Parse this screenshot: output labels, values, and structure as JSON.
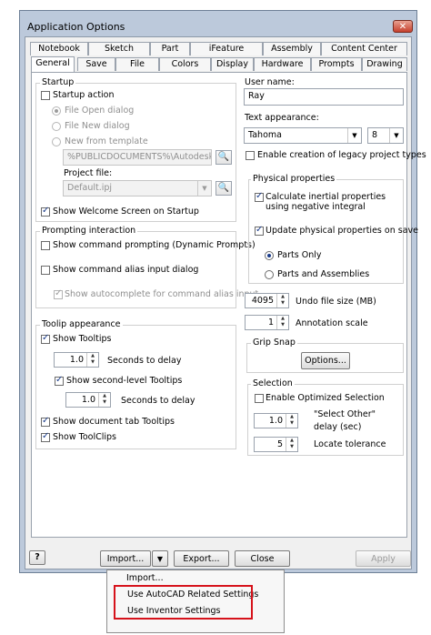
{
  "window": {
    "title": "Application Options",
    "close_glyph": "✕"
  },
  "tabs_row1": [
    "Notebook",
    "Sketch",
    "Part",
    "iFeature",
    "Assembly",
    "Content Center"
  ],
  "tabs_row2": [
    "General",
    "Save",
    "File",
    "Colors",
    "Display",
    "Hardware",
    "Prompts",
    "Drawing"
  ],
  "startup": {
    "group_label": "Startup",
    "startup_action": "Startup action",
    "file_open": "File Open dialog",
    "file_new": "File New dialog",
    "new_from_template": "New from template",
    "template_path": "%PUBLICDOCUMENTS%\\Autodesk\\Inv",
    "project_file_label": "Project file:",
    "project_file_value": "Default.ipj",
    "welcome_screen": "Show Welcome Screen on Startup"
  },
  "prompting": {
    "group_label": "Prompting interaction",
    "dynamic_prompts": "Show command prompting (Dynamic Prompts)",
    "alias_dialog": "Show command alias input dialog",
    "autocomplete": "Show autocomplete for command alias input"
  },
  "tooltip": {
    "group_label": "Toolip appearance",
    "show_tooltips": "Show Tooltips",
    "delay_value": "1.0",
    "delay_label": "Seconds to delay",
    "second_level": "Show second-level Tooltips",
    "delay2_value": "1.0",
    "delay2_label": "Seconds to delay",
    "doc_tab": "Show document tab Tooltips",
    "toolclips": "Show ToolClips"
  },
  "user": {
    "label": "User name:",
    "value": "Ray"
  },
  "text_appearance": {
    "label": "Text appearance:",
    "font": "Tahoma",
    "size": "8",
    "legacy": "Enable creation of legacy project types"
  },
  "physical": {
    "group_label": "Physical properties",
    "inertial": "Calculate inertial properties using negative integral",
    "update": "Update physical properties on save",
    "parts_only": "Parts Only",
    "parts_assemblies": "Parts and Assemblies"
  },
  "undo": {
    "value": "4095",
    "label": "Undo file size (MB)"
  },
  "annotation": {
    "value": "1",
    "label": "Annotation scale"
  },
  "grip": {
    "group_label": "Grip Snap",
    "options_button": "Options..."
  },
  "selection": {
    "group_label": "Selection",
    "optimized": "Enable Optimized Selection",
    "select_other_value": "1.0",
    "select_other_label_1": "\"Select Other\"",
    "select_other_label_2": "delay (sec)",
    "locate_value": "5",
    "locate_label": "Locate tolerance"
  },
  "footer": {
    "help_glyph": "?",
    "import_button": "Import...",
    "export_button": "Export...",
    "close_button": "Close",
    "apply_button": "Apply"
  },
  "import_menu": [
    "Import...",
    "Use AutoCAD Related Settings",
    "Use Inventor Settings"
  ]
}
